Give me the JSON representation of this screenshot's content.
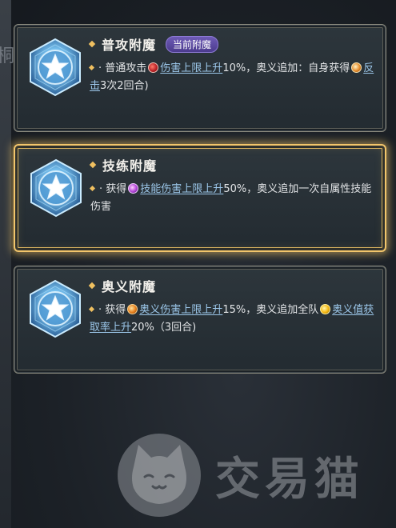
{
  "background": {
    "edge_glyph": "桐"
  },
  "colors": {
    "accent_gold": "#f0c060",
    "link_blue": "#9cc7ea",
    "badge_purple": "#5d4aa2",
    "selected_border": "#f2c56b"
  },
  "panels": [
    {
      "title": "普攻附魔",
      "badge": "当前附魔",
      "icon": "blue-star-hexagon-icon",
      "desc": {
        "bullet": "·",
        "t1": "普通攻击",
        "i1": "red-damage-icon",
        "link1": "伤害上限上升",
        "t2": "10%，奥义追加：自身获得",
        "i2": "counter-icon",
        "link2": "反击",
        "t3": "3次2回合)"
      }
    },
    {
      "title": "技练附魔",
      "selected": true,
      "icon": "blue-star-hexagon-icon",
      "desc": {
        "bullet": "·",
        "t1": "获得",
        "i1": "purple-skill-icon",
        "link1": "技能伤害上限上升",
        "t2": "50%，奥义追加一次自属性技能伤害"
      }
    },
    {
      "title": "奥义附魔",
      "icon": "blue-star-hexagon-icon",
      "desc": {
        "bullet": "·",
        "t1": "获得",
        "i1": "orange-ougi-icon",
        "link1": "奥义伤害上限上升",
        "t2": "15%，奥义追加全队",
        "i2": "yellow-ougi-charge-icon",
        "link2": "奥义值获取率上升",
        "t3": "20%（3回合)"
      }
    }
  ],
  "watermark": {
    "text": "交易猫",
    "icon": "cat-logo-icon"
  }
}
